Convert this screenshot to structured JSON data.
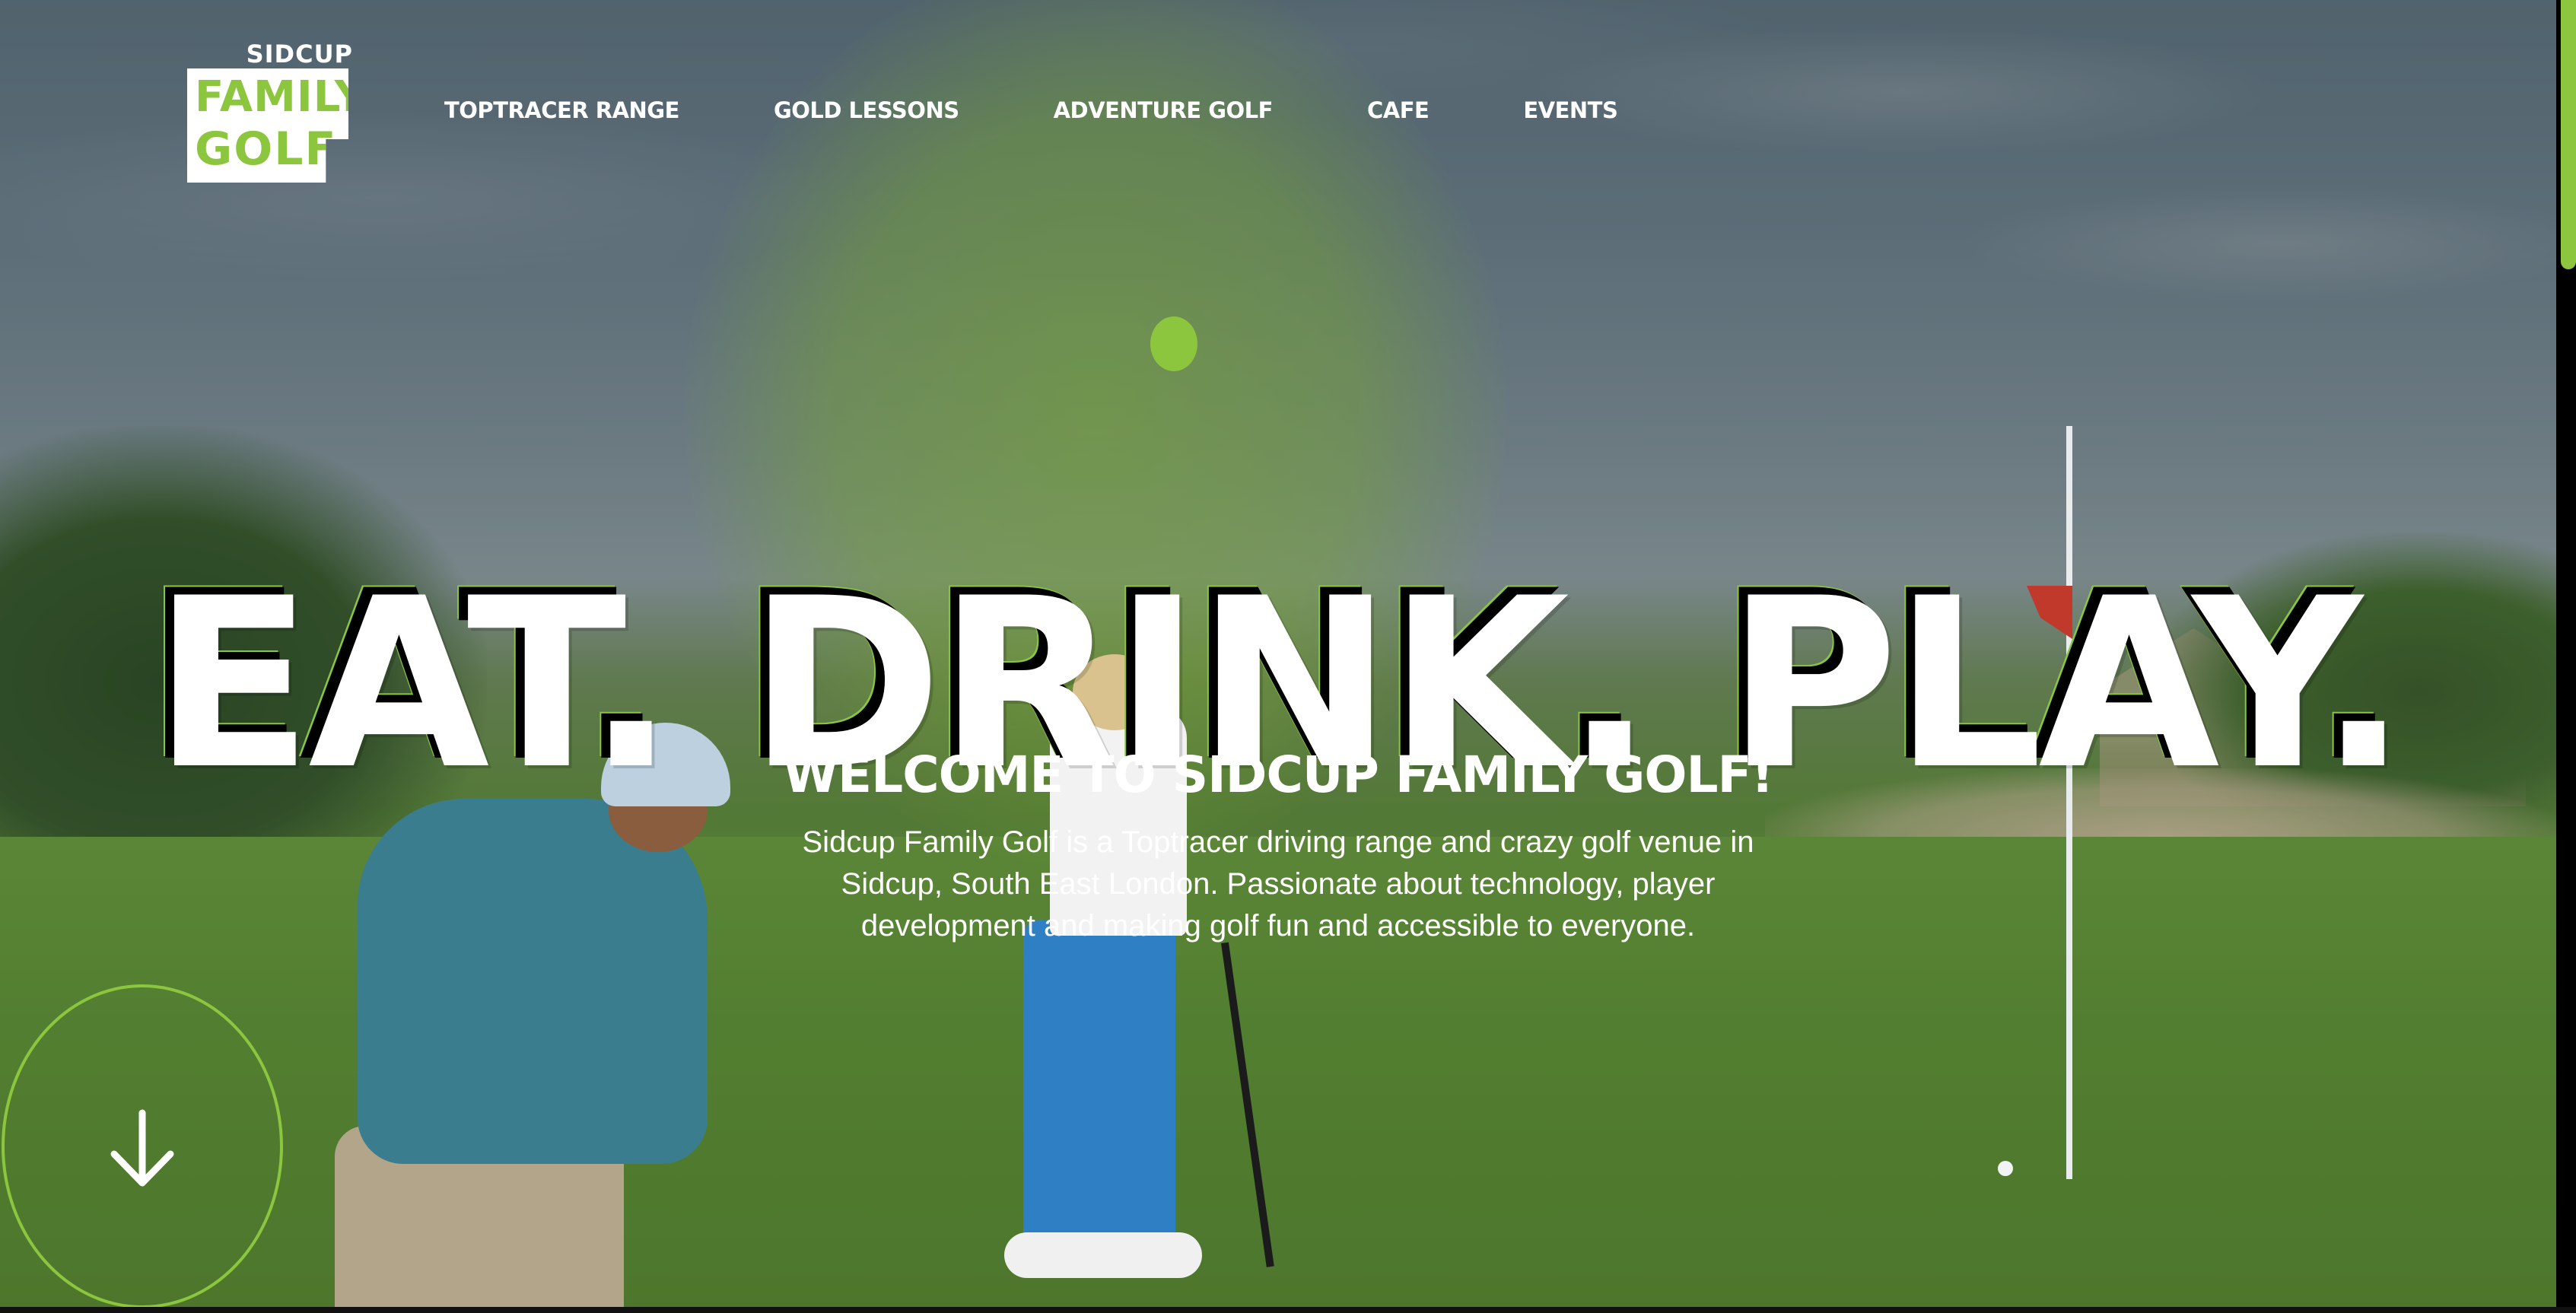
{
  "logo": {
    "top": "SIDCUP",
    "line1": "FAMILY",
    "line2": "GOLF"
  },
  "nav": {
    "items": [
      {
        "label": "TOPTRACER RANGE"
      },
      {
        "label": "GOLD LESSONS"
      },
      {
        "label": "ADVENTURE GOLF"
      },
      {
        "label": "CAFE"
      },
      {
        "label": "EVENTS"
      }
    ]
  },
  "hero": {
    "headline": "EAT. DRINK. PLAY.",
    "welcome": "WELCOME TO SIDCUP FAMILY GOLF!",
    "intro": "Sidcup Family Golf is a Toptracer driving range and crazy golf venue in Sidcup, South East London. Passionate about technology, player development and making golf fun and accessible to everyone."
  },
  "scroll_button": {
    "icon": "arrow-down-icon"
  },
  "colors": {
    "accent": "#8cc63f",
    "text": "#ffffff",
    "scrollbar_track": "#000000"
  }
}
